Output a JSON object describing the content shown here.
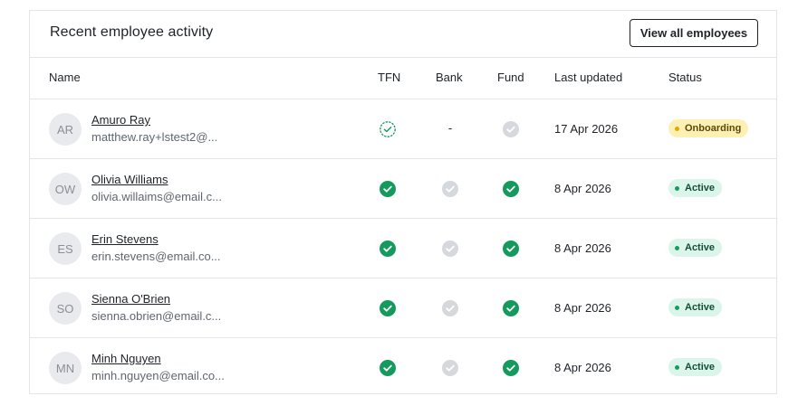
{
  "header": {
    "title": "Recent employee activity",
    "view_all_label": "View all employees"
  },
  "columns": {
    "name": "Name",
    "tfn": "TFN",
    "bank": "Bank",
    "fund": "Fund",
    "last_updated": "Last updated",
    "status": "Status"
  },
  "rows": [
    {
      "initials": "AR",
      "name": "Amuro Ray",
      "email": "matthew.ray+lstest2@...",
      "tfn": "pending-check",
      "bank": "-",
      "fund": "grey-check",
      "last_updated": "17 Apr 2026",
      "status": "Onboarding",
      "status_kind": "onboarding"
    },
    {
      "initials": "OW",
      "name": "Olivia Williams",
      "email": "olivia.willaims@email.c...",
      "tfn": "green-check",
      "bank": "grey-check",
      "fund": "green-check",
      "last_updated": "8 Apr 2026",
      "status": "Active",
      "status_kind": "active"
    },
    {
      "initials": "ES",
      "name": "Erin Stevens",
      "email": "erin.stevens@email.co...",
      "tfn": "green-check",
      "bank": "grey-check",
      "fund": "green-check",
      "last_updated": "8 Apr 2026",
      "status": "Active",
      "status_kind": "active"
    },
    {
      "initials": "SO",
      "name": "Sienna O'Brien",
      "email": "sienna.obrien@email.c...",
      "tfn": "green-check",
      "bank": "grey-check",
      "fund": "green-check",
      "last_updated": "8 Apr 2026",
      "status": "Active",
      "status_kind": "active"
    },
    {
      "initials": "MN",
      "name": "Minh Nguyen",
      "email": "minh.nguyen@email.co...",
      "tfn": "green-check",
      "bank": "grey-check",
      "fund": "green-check",
      "last_updated": "8 Apr 2026",
      "status": "Active",
      "status_kind": "active"
    }
  ],
  "colors": {
    "green_check": "#159a5e",
    "grey_check": "#d5d8dc",
    "onboarding_badge": "#fdf0b4",
    "active_badge": "#dcf5ea"
  }
}
